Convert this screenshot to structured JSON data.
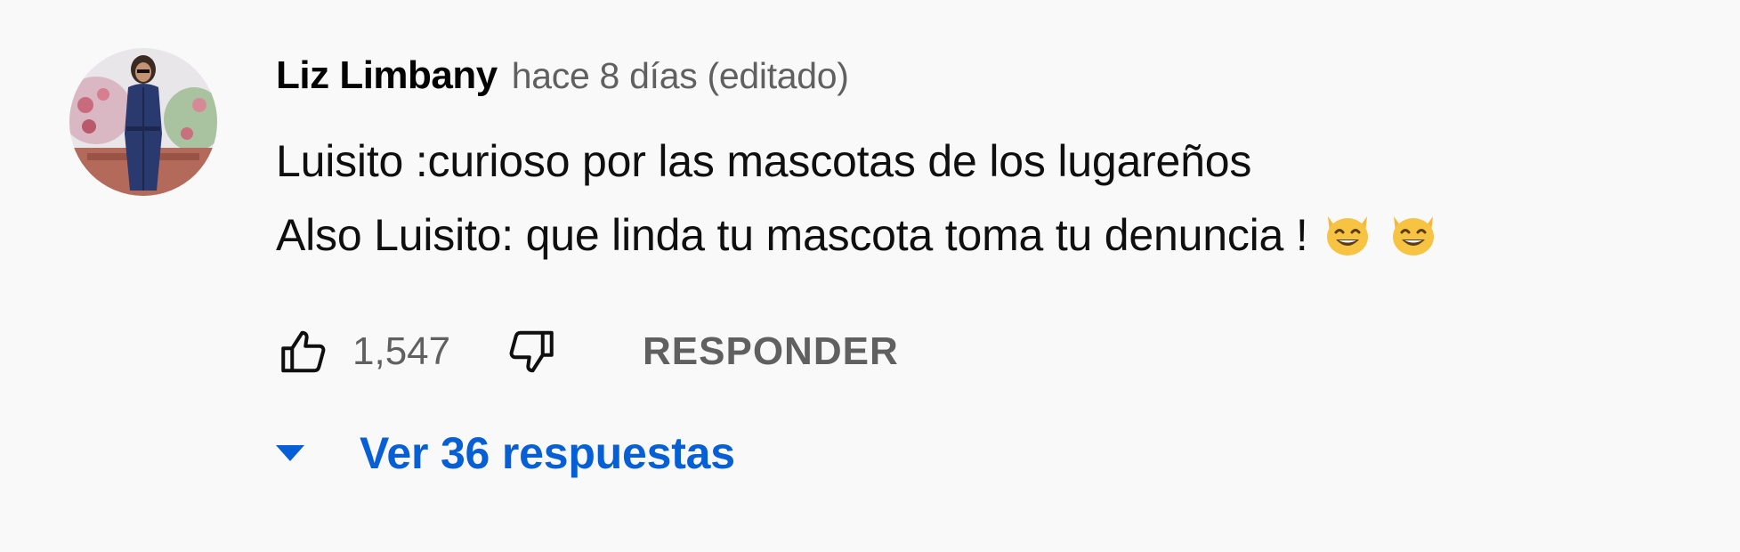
{
  "comment": {
    "author": "Liz Limbany",
    "timestamp": "hace 8 días (editado)",
    "text_lines": [
      "Luisito :curioso por las mascotas de los lugareños",
      "Also Luisito: que linda tu mascota toma tu denuncia !"
    ],
    "emojis": [
      "grinning-cat-emoji",
      "grinning-cat-emoji"
    ],
    "like_count": "1,547",
    "reply_label": "RESPONDER",
    "view_replies_label": "Ver 36 respuestas",
    "colors": {
      "link_blue": "#065fd4",
      "secondary_text": "#606060",
      "background": "#f9f9f9"
    },
    "icons": {
      "like": "thumbs-up-icon",
      "dislike": "thumbs-down-icon",
      "expand": "caret-down-icon"
    }
  }
}
